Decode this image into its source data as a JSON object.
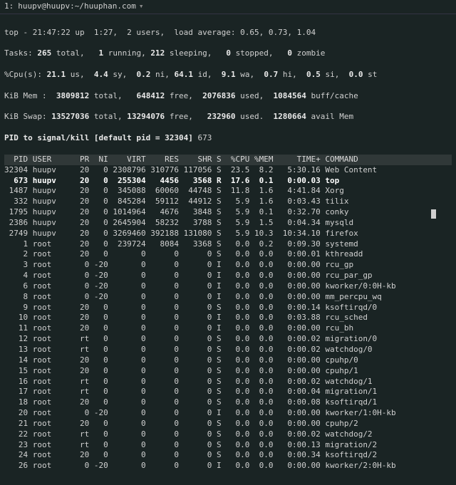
{
  "titlebar": {
    "index": "1:",
    "title": "huupv@huupv:~/huuphan.com",
    "chevron": "▾"
  },
  "summary": {
    "line1": "top - 21:47:22 up  1:27,  2 users,  load average: 0.65, 0.73, 1.04",
    "line2_a": "Tasks: ",
    "line2_total": "265 ",
    "line2_b": "total,   ",
    "line2_run": "1 ",
    "line2_c": "running, ",
    "line2_sleep": "212 ",
    "line2_d": "sleeping,   ",
    "line2_stop": "0 ",
    "line2_e": "stopped,   ",
    "line2_zom": "0 ",
    "line2_f": "zombie",
    "line3_a": "%Cpu(s): ",
    "line3_us": "21.1 ",
    "line3_b": "us,  ",
    "line3_sy": "4.4 ",
    "line3_c": "sy,  ",
    "line3_ni": "0.2 ",
    "line3_d": "ni, ",
    "line3_id": "64.1 ",
    "line3_e": "id,  ",
    "line3_wa": "9.1 ",
    "line3_f": "wa,  ",
    "line3_hi": "0.7 ",
    "line3_g": "hi,  ",
    "line3_si": "0.5 ",
    "line3_h": "si,  ",
    "line3_st": "0.0 ",
    "line3_i": "st",
    "line4_a": "KiB Mem : ",
    "line4_total": " 3809812 ",
    "line4_b": "total,   ",
    "line4_free": "648412 ",
    "line4_c": "free,  ",
    "line4_used": "2076836 ",
    "line4_d": "used,  ",
    "line4_buff": "1084564 ",
    "line4_e": "buff/cache",
    "line5_a": "KiB Swap: ",
    "line5_total": "13527036 ",
    "line5_b": "total, ",
    "line5_free": "13294076 ",
    "line5_c": "free,   ",
    "line5_used": "232960 ",
    "line5_d": "used.  ",
    "line5_avail": "1280664 ",
    "line5_e": "avail Mem",
    "prompt": "PID to signal/kill [default pid = 32304] ",
    "prompt_input": "673"
  },
  "columns": "  PID USER      PR  NI    VIRT    RES    SHR S  %CPU %MEM     TIME+ COMMAND       ",
  "rows": [
    {
      "text": "32304 huupv     20   0 2308796 310776 117056 S  23.5  8.2   5:30.16 Web Content   ",
      "hl": false
    },
    {
      "text": "  673 huupv     20   0  255304   4456   3568 R  17.6  0.1   0:00.03 top           ",
      "hl": true
    },
    {
      "text": " 1487 huupv     20   0  345088  60060  44748 S  11.8  1.6   4:41.84 Xorg          ",
      "hl": false
    },
    {
      "text": "  332 huupv     20   0  845284  59112  44912 S   5.9  1.6   0:03.43 tilix         ",
      "hl": false
    },
    {
      "text": " 1795 huupv     20   0 1014964   4676   3848 S   5.9  0.1   0:32.70 conky         ",
      "hl": false
    },
    {
      "text": " 2386 huupv     20   0 2645904  58232   3788 S   5.9  1.5   0:04.34 mysqld        ",
      "hl": false
    },
    {
      "text": " 2749 huupv     20   0 3269460 392188 131080 S   5.9 10.3  10:34.10 firefox       ",
      "hl": false
    },
    {
      "text": "    1 root      20   0  239724   8084   3368 S   0.0  0.2   0:09.30 systemd       ",
      "hl": false
    },
    {
      "text": "    2 root      20   0       0      0      0 S   0.0  0.0   0:00.01 kthreadd      ",
      "hl": false
    },
    {
      "text": "    3 root       0 -20       0      0      0 I   0.0  0.0   0:00.00 rcu_gp        ",
      "hl": false
    },
    {
      "text": "    4 root       0 -20       0      0      0 I   0.0  0.0   0:00.00 rcu_par_gp    ",
      "hl": false
    },
    {
      "text": "    6 root       0 -20       0      0      0 I   0.0  0.0   0:00.00 kworker/0:0H-kb",
      "hl": false
    },
    {
      "text": "    8 root       0 -20       0      0      0 I   0.0  0.0   0:00.00 mm_percpu_wq  ",
      "hl": false
    },
    {
      "text": "    9 root      20   0       0      0      0 S   0.0  0.0   0:00.14 ksoftirqd/0   ",
      "hl": false
    },
    {
      "text": "   10 root      20   0       0      0      0 I   0.0  0.0   0:03.88 rcu_sched     ",
      "hl": false
    },
    {
      "text": "   11 root      20   0       0      0      0 I   0.0  0.0   0:00.00 rcu_bh        ",
      "hl": false
    },
    {
      "text": "   12 root      rt   0       0      0      0 S   0.0  0.0   0:00.02 migration/0   ",
      "hl": false
    },
    {
      "text": "   13 root      rt   0       0      0      0 S   0.0  0.0   0:00.02 watchdog/0    ",
      "hl": false
    },
    {
      "text": "   14 root      20   0       0      0      0 S   0.0  0.0   0:00.00 cpuhp/0       ",
      "hl": false
    },
    {
      "text": "   15 root      20   0       0      0      0 S   0.0  0.0   0:00.00 cpuhp/1       ",
      "hl": false
    },
    {
      "text": "   16 root      rt   0       0      0      0 S   0.0  0.0   0:00.02 watchdog/1    ",
      "hl": false
    },
    {
      "text": "   17 root      rt   0       0      0      0 S   0.0  0.0   0:00.04 migration/1   ",
      "hl": false
    },
    {
      "text": "   18 root      20   0       0      0      0 S   0.0  0.0   0:00.08 ksoftirqd/1   ",
      "hl": false
    },
    {
      "text": "   20 root       0 -20       0      0      0 I   0.0  0.0   0:00.00 kworker/1:0H-kb",
      "hl": false
    },
    {
      "text": "   21 root      20   0       0      0      0 S   0.0  0.0   0:00.00 cpuhp/2       ",
      "hl": false
    },
    {
      "text": "   22 root      rt   0       0      0      0 S   0.0  0.0   0:00.02 watchdog/2    ",
      "hl": false
    },
    {
      "text": "   23 root      rt   0       0      0      0 S   0.0  0.0   0:00.13 migration/2   ",
      "hl": false
    },
    {
      "text": "   24 root      20   0       0      0      0 S   0.0  0.0   0:00.34 ksoftirqd/2   ",
      "hl": false
    },
    {
      "text": "   26 root       0 -20       0      0      0 I   0.0  0.0   0:00.00 kworker/2:0H-kb",
      "hl": false
    }
  ]
}
